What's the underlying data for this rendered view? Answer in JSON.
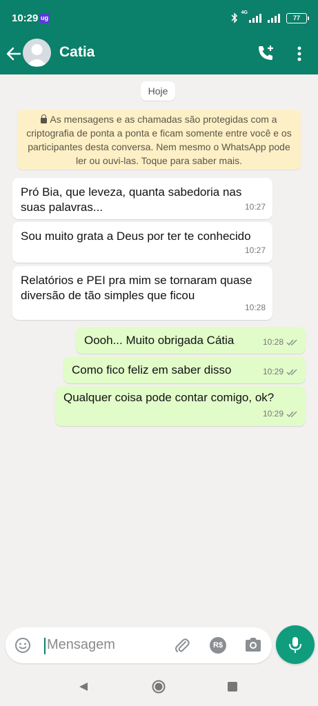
{
  "status_bar": {
    "time": "10:29",
    "app_badge": "ug",
    "network_label": "4G",
    "battery": "77"
  },
  "header": {
    "contact_name": "Catia"
  },
  "chat": {
    "date_chip": "Hoje",
    "encryption_notice": "As mensagens e as chamadas são protegidas com a criptografia de ponta a ponta e ficam somente entre você e os participantes desta conversa. Nem mesmo o WhatsApp pode ler ou ouvi-las. Toque para saber mais.",
    "messages": [
      {
        "direction": "in",
        "text": "Pró Bia, que leveza, quanta sabedoria nas suas palavras...",
        "time": "10:27"
      },
      {
        "direction": "in",
        "text": "Sou muito grata a Deus por ter te conhecido",
        "time": "10:27"
      },
      {
        "direction": "in",
        "text": "Relatórios e PEI pra mim se tornaram quase diversão de tão simples que ficou",
        "time": "10:28"
      },
      {
        "direction": "out",
        "text": "Oooh... Muito obrigada Cátia",
        "time": "10:28",
        "status": "read"
      },
      {
        "direction": "out",
        "text": "Como fico feliz em saber disso",
        "time": "10:29",
        "status": "read"
      },
      {
        "direction": "out",
        "text": "Qualquer coisa pode contar comigo, ok?",
        "time": "10:29",
        "status": "read"
      }
    ]
  },
  "composer": {
    "placeholder": "Mensagem",
    "payment_label": "R$"
  },
  "icons": {
    "header": [
      "back-arrow-icon",
      "avatar",
      "add-call-icon",
      "more-vert-icon"
    ],
    "composer": [
      "emoji-icon",
      "attach-icon",
      "payment-icon",
      "camera-icon",
      "mic-icon"
    ],
    "nav": [
      "nav-back-icon",
      "nav-home-icon",
      "nav-recents-icon"
    ]
  },
  "colors": {
    "header": "#0b806a",
    "incoming_bubble": "#ffffff",
    "outgoing_bubble": "#e1fcc9",
    "notice_bg": "#fdf0c6",
    "read_ticks": "#8a8a8a",
    "mic_button": "#0f9d7e"
  }
}
